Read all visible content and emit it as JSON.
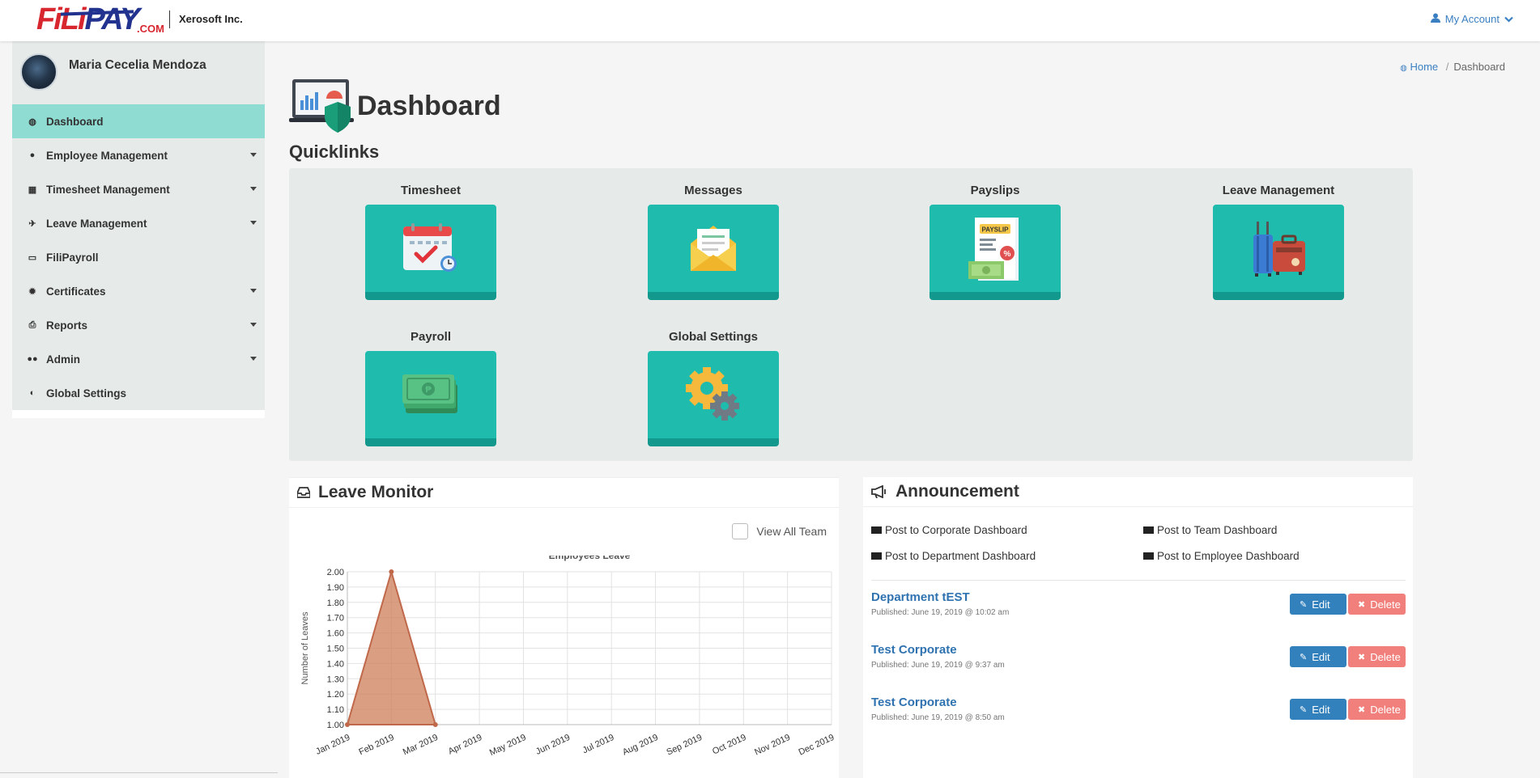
{
  "header": {
    "logo_text_red": "FiLi",
    "logo_text_blue": "PAY",
    "logo_suffix": ".COM",
    "company": "Xerosoft Inc.",
    "account_label": "My Account"
  },
  "sidebar": {
    "user_name": "Maria Cecelia Mendoza",
    "items": [
      {
        "label": "Dashboard",
        "icon": "dashboard-icon",
        "active": true
      },
      {
        "label": "Employee Management",
        "icon": "user-icon",
        "dropdown": true
      },
      {
        "label": "Timesheet Management",
        "icon": "calendar-icon",
        "dropdown": true
      },
      {
        "label": "Leave Management",
        "icon": "plane-icon",
        "dropdown": true
      },
      {
        "label": "FiliPayroll",
        "icon": "credit-card-icon"
      },
      {
        "label": "Certificates",
        "icon": "certificate-icon",
        "dropdown": true
      },
      {
        "label": "Reports",
        "icon": "print-icon",
        "dropdown": true
      },
      {
        "label": "Admin",
        "icon": "users-icon",
        "dropdown": true
      },
      {
        "label": "Global Settings",
        "icon": "globe-icon"
      }
    ]
  },
  "breadcrumb": {
    "home": "Home",
    "current": "Dashboard"
  },
  "page_title": "Dashboard",
  "quicklinks": {
    "title": "Quicklinks",
    "items": [
      {
        "label": "Timesheet",
        "icon": "calendar-check-icon"
      },
      {
        "label": "Messages",
        "icon": "envelope-icon"
      },
      {
        "label": "Payslips",
        "icon": "payslip-icon",
        "icon_text": "PAYSLIP"
      },
      {
        "label": "Leave Management",
        "icon": "luggage-icon"
      },
      {
        "label": "Payroll",
        "icon": "cash-icon"
      },
      {
        "label": "Global Settings",
        "icon": "gears-icon"
      }
    ]
  },
  "leave_monitor": {
    "title": "Leave Monitor",
    "view_all_label": "View All Team"
  },
  "chart_data": {
    "type": "area",
    "title": "Employees Leave",
    "xlabel": "",
    "ylabel": "Number of Leaves",
    "x": [
      "Jan 2019",
      "Feb 2019",
      "Mar 2019",
      "Apr 2019",
      "May 2019",
      "Jun 2019",
      "Jul 2019",
      "Aug 2019",
      "Sep 2019",
      "Oct 2019",
      "Nov 2019",
      "Dec 2019"
    ],
    "series": [
      {
        "values": [
          1.0,
          2.0,
          1.0
        ]
      }
    ],
    "yticks": [
      "2.00",
      "1.90",
      "1.80",
      "1.70",
      "1.60",
      "1.50",
      "1.40",
      "1.30",
      "1.20",
      "1.10",
      "1.00"
    ],
    "ylim": [
      1.0,
      2.0
    ],
    "grid": true,
    "color": "#cd7f5a"
  },
  "announcement": {
    "title": "Announcement",
    "post_links": [
      "Post to Corporate Dashboard",
      "Post to Team Dashboard",
      "Post to Department Dashboard",
      "Post to Employee Dashboard"
    ],
    "items": [
      {
        "title": "Department tEST",
        "published": "Published: June 19, 2019 @ 10:02 am"
      },
      {
        "title": "Test Corporate",
        "published": "Published: June 19, 2019 @ 9:37 am"
      },
      {
        "title": "Test Corporate",
        "published": "Published: June 19, 2019 @ 8:50 am"
      }
    ],
    "edit_label": "Edit",
    "delete_label": "Delete"
  },
  "colors": {
    "accent_teal": "#1fbcae",
    "active_nav": "#8fdcd2",
    "link_blue": "#2f72b0",
    "delete_red": "#f1807c"
  }
}
